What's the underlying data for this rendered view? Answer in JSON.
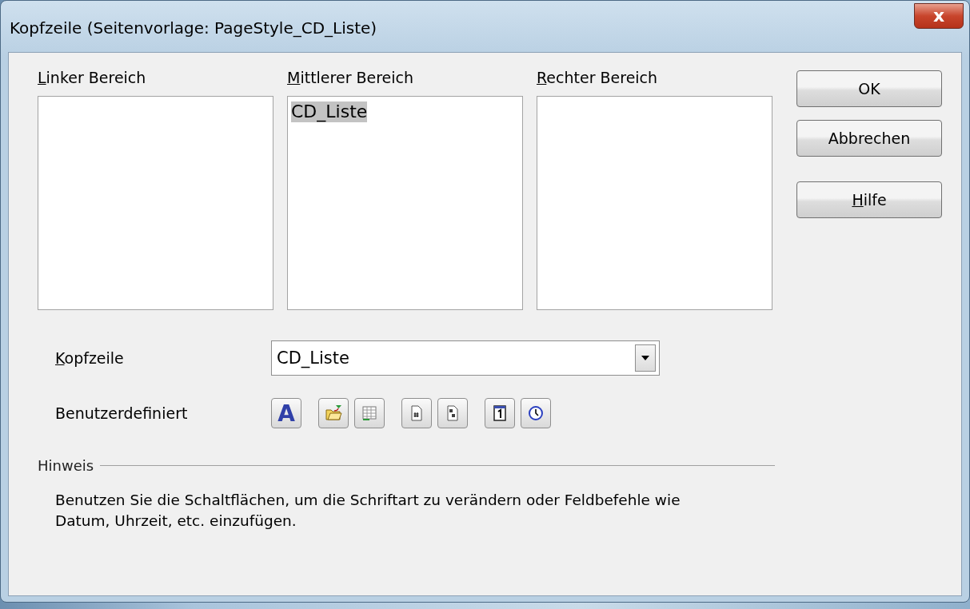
{
  "window": {
    "title": "Kopfzeile (Seitenvorlage: PageStyle_CD_Liste)",
    "close": "x"
  },
  "areas": [
    {
      "label": "Linker Bereich",
      "underline_first": true
    },
    {
      "label": "Mittlerer Bereich",
      "underline_first": true,
      "lines": [
        {
          "text": "CD_Liste",
          "selected": true
        }
      ]
    },
    {
      "label": "Rechter Bereich",
      "underline_first": true
    }
  ],
  "buttons": [
    {
      "label": "OK",
      "underline_first": false
    },
    {
      "label": "Abbrechen",
      "underline_first": false
    },
    {
      "label": "Hilfe",
      "underline_first": true
    }
  ],
  "header_select": {
    "label": "Kopfzeile",
    "underline_first": true,
    "value": "CD_Liste"
  },
  "custom": {
    "label": "Benutzerdefiniert",
    "tools": [
      {
        "kind": "font",
        "glyph": "A"
      },
      {
        "kind": "file"
      },
      {
        "kind": "sheet"
      },
      {
        "kind": "page"
      },
      {
        "kind": "pages"
      },
      {
        "kind": "date"
      },
      {
        "kind": "time"
      }
    ]
  },
  "hint": {
    "title": "Hinweis",
    "text": "Benutzen Sie die Schaltflächen, um die Schriftart zu verändern oder Feldbefehle wie Datum, Uhrzeit, etc. einzufügen."
  }
}
